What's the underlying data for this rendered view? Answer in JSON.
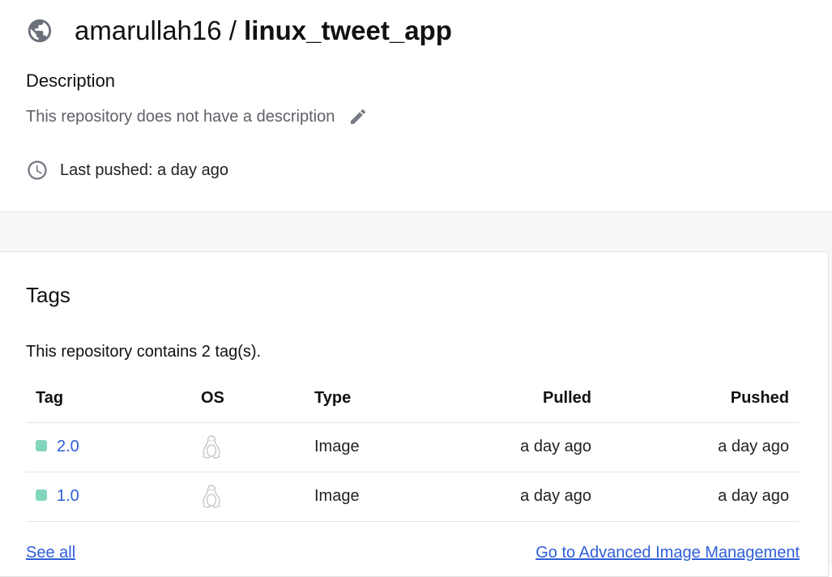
{
  "repo": {
    "owner": "amarullah16",
    "separator": "/",
    "name": "linux_tweet_app",
    "icon": "globe-icon"
  },
  "description": {
    "heading": "Description",
    "text": "This repository does not have a description",
    "edit_icon": "pencil-icon"
  },
  "last_pushed": {
    "icon": "clock-icon",
    "text": "Last pushed: a day ago"
  },
  "tags": {
    "title": "Tags",
    "summary": "This repository contains 2 tag(s).",
    "columns": [
      "Tag",
      "OS",
      "Type",
      "Pulled",
      "Pushed"
    ],
    "rows": [
      {
        "tag": "2.0",
        "os_icon": "linux-icon",
        "type": "Image",
        "pulled": "a day ago",
        "pushed": "a day ago",
        "status_color": "#82d6bd"
      },
      {
        "tag": "1.0",
        "os_icon": "linux-icon",
        "type": "Image",
        "pulled": "a day ago",
        "pushed": "a day ago",
        "status_color": "#82d6bd"
      }
    ],
    "see_all": "See all",
    "advanced": "Go to Advanced Image Management"
  },
  "colors": {
    "link": "#2f5fd7",
    "status_active": "#82d6bd",
    "muted_text": "#5f6168"
  }
}
